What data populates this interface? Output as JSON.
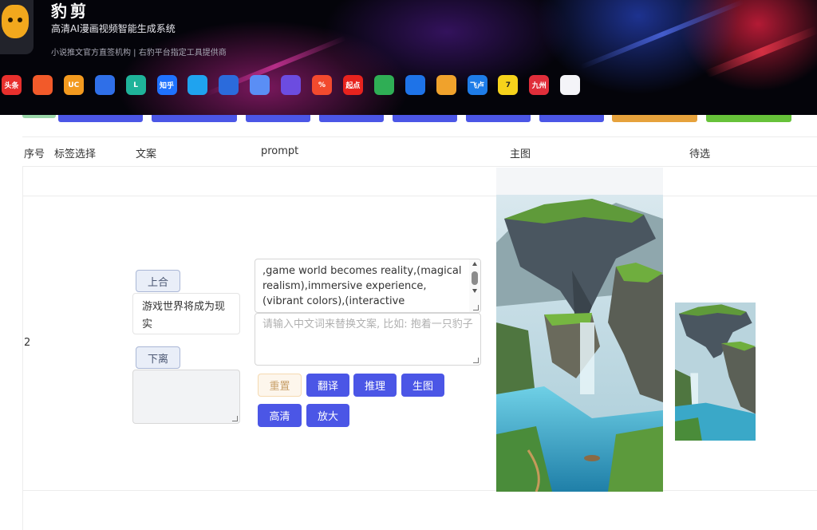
{
  "app": {
    "title": "豹剪",
    "subtitle": "高清AI漫画视频智能生成系统",
    "description": "小说推文官方直签机构  |  右豹平台指定工具提供商",
    "platform_icons": [
      {
        "name": "toutiao-icon",
        "label": "头条",
        "color": "#e8302d",
        "text_color": "#ffffff"
      },
      {
        "name": "fanqie-icon",
        "label": "",
        "color": "#f25a2a",
        "text_color": "#ffffff"
      },
      {
        "name": "uc-icon",
        "label": "UC",
        "color": "#f39a1f",
        "text_color": "#ffffff"
      },
      {
        "name": "baidu-icon",
        "label": "",
        "color": "#2f6fe8",
        "text_color": "#ffffff"
      },
      {
        "name": "lofter-icon",
        "label": "L",
        "color": "#1fb39a",
        "text_color": "#ffffff"
      },
      {
        "name": "zhihu-icon",
        "label": "知乎",
        "color": "#1f72ff",
        "text_color": "#ffffff"
      },
      {
        "name": "qq-icon",
        "label": "",
        "color": "#1fa3ef",
        "text_color": "#ffffff"
      },
      {
        "name": "bubble-icon",
        "label": "",
        "color": "#2b6bdc",
        "text_color": "#ffffff"
      },
      {
        "name": "wave-icon",
        "label": "",
        "color": "#5a8ef5",
        "text_color": "#ffffff"
      },
      {
        "name": "ring-icon",
        "label": "",
        "color": "#6c4ce0",
        "text_color": "#ffffff"
      },
      {
        "name": "percent-icon",
        "label": "%",
        "color": "#f24a2e",
        "text_color": "#ffffff"
      },
      {
        "name": "qidian-icon",
        "label": "起点",
        "color": "#e8231e",
        "text_color": "#ffffff"
      },
      {
        "name": "reading-icon",
        "label": "",
        "color": "#2fae55",
        "text_color": "#ffffff"
      },
      {
        "name": "bird-icon",
        "label": "",
        "color": "#1e73e8",
        "text_color": "#ffffff"
      },
      {
        "name": "flame-icon",
        "label": "",
        "color": "#f0a22c",
        "text_color": "#ffffff"
      },
      {
        "name": "feilu-icon",
        "label": "飞卢",
        "color": "#1e7ce8",
        "text_color": "#ffffff"
      },
      {
        "name": "qimao-icon",
        "label": "7",
        "color": "#f6d21b",
        "text_color": "#222222"
      },
      {
        "name": "jiuzhou-icon",
        "label": "九州",
        "color": "#e02e3a",
        "text_color": "#ffffff"
      },
      {
        "name": "video-icon",
        "label": "",
        "color": "#f4f4f8",
        "text_color": "#e0408a"
      }
    ]
  },
  "toolbar_colors": [
    "#4b56e6",
    "#4b56e6",
    "#4b56e6",
    "#4b56e6",
    "#4b56e6",
    "#4b56e6",
    "#4b56e6",
    "#e6a23c",
    "#67c23a"
  ],
  "table": {
    "headers": {
      "index": "序号",
      "tag": "标签选择",
      "copy": "文案",
      "prompt": "prompt",
      "main_image": "主图",
      "candidates": "待选"
    },
    "row": {
      "index": "2",
      "merge_up_label": "上合",
      "split_down_label": "下离",
      "copy_text": "游戏世界将成为现实",
      "prompt_text": ",game world becomes reality,(magical realism),immersive experience,(vibrant colors),(interactive",
      "cn_input_placeholder": "请输入中文词来替换文案, 比如: 抱着一只豹子",
      "actions": {
        "reset": "重置",
        "translate": "翻译",
        "infer": "推理",
        "generate": "生图",
        "hd": "高清",
        "upscale": "放大"
      }
    }
  },
  "colors": {
    "accent_blue": "#4b56e6",
    "reset_bg": "#fdf6ec",
    "reset_text": "#c8a06a"
  }
}
